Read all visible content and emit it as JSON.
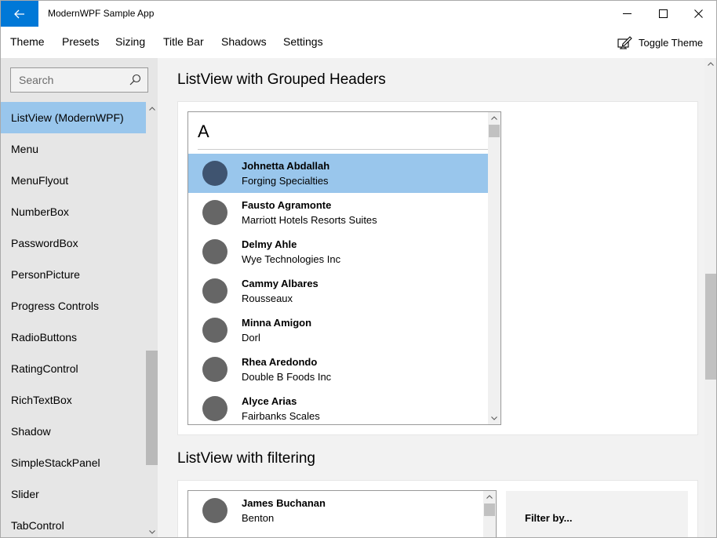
{
  "window": {
    "title": "ModernWPF Sample App",
    "accent_color": "#0078d7",
    "selection_color": "#99c6ec"
  },
  "titlebar": {
    "back_icon": "arrow-left-icon",
    "caption_icons": [
      "minimize-icon",
      "maximize-icon",
      "close-icon"
    ]
  },
  "menu": {
    "items": [
      "Theme",
      "Presets",
      "Sizing",
      "Title Bar",
      "Shadows",
      "Settings"
    ],
    "toggle_theme_label": "Toggle Theme",
    "toggle_theme_icon": "edit-theme-icon"
  },
  "sidebar": {
    "search_placeholder": "Search",
    "items": [
      "ListView (ModernWPF)",
      "Menu",
      "MenuFlyout",
      "NumberBox",
      "PasswordBox",
      "PersonPicture",
      "Progress Controls",
      "RadioButtons",
      "RatingControl",
      "RichTextBox",
      "Shadow",
      "SimpleStackPanel",
      "Slider",
      "TabControl"
    ],
    "selected_index": 0
  },
  "main": {
    "grouped_section": {
      "title": "ListView with Grouped Headers",
      "group_header": "A",
      "people": [
        {
          "name": "Johnetta Abdallah",
          "company": "Forging Specialties"
        },
        {
          "name": "Fausto Agramonte",
          "company": "Marriott Hotels Resorts Suites"
        },
        {
          "name": "Delmy Ahle",
          "company": "Wye Technologies Inc"
        },
        {
          "name": "Cammy Albares",
          "company": "Rousseaux"
        },
        {
          "name": "Minna Amigon",
          "company": "Dorl"
        },
        {
          "name": "Rhea Aredondo",
          "company": "Double B Foods Inc"
        },
        {
          "name": "Alyce Arias",
          "company": "Fairbanks Scales"
        }
      ],
      "selected_index": 0
    },
    "filter_section": {
      "title": "ListView with filtering",
      "people": [
        {
          "name": "James Buchanan",
          "company": "Benton"
        }
      ],
      "filter_title": "Filter by..."
    }
  }
}
